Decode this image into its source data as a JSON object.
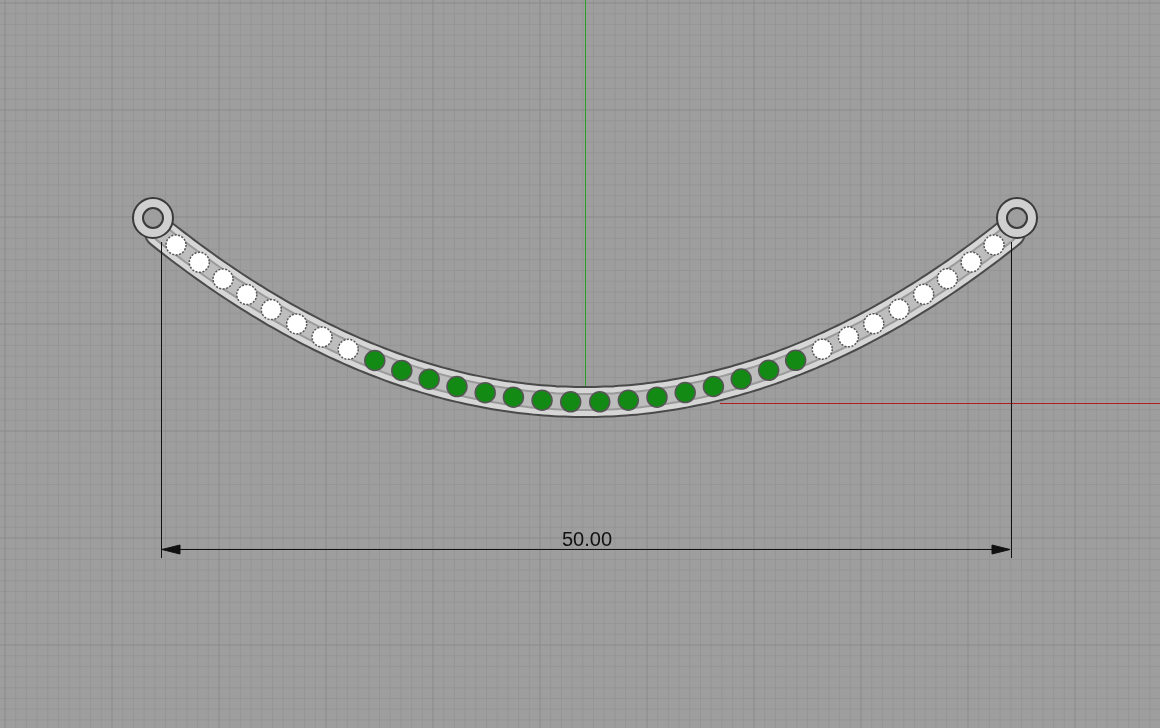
{
  "viewport": {
    "dimension": {
      "label": "50.00"
    },
    "stones": [
      {
        "color": "#ffffff"
      },
      {
        "color": "#ffffff"
      },
      {
        "color": "#ffffff"
      },
      {
        "color": "#ffffff"
      },
      {
        "color": "#ffffff"
      },
      {
        "color": "#ffffff"
      },
      {
        "color": "#ffffff"
      },
      {
        "color": "#ffffff"
      },
      {
        "color": "#138a13"
      },
      {
        "color": "#138a13"
      },
      {
        "color": "#138a13"
      },
      {
        "color": "#138a13"
      },
      {
        "color": "#138a13"
      },
      {
        "color": "#138a13"
      },
      {
        "color": "#138a13"
      },
      {
        "color": "#138a13"
      },
      {
        "color": "#138a13"
      },
      {
        "color": "#138a13"
      },
      {
        "color": "#138a13"
      },
      {
        "color": "#138a13"
      },
      {
        "color": "#138a13"
      },
      {
        "color": "#138a13"
      },
      {
        "color": "#138a13"
      },
      {
        "color": "#138a13"
      },
      {
        "color": "#ffffff"
      },
      {
        "color": "#ffffff"
      },
      {
        "color": "#ffffff"
      },
      {
        "color": "#ffffff"
      },
      {
        "color": "#ffffff"
      },
      {
        "color": "#ffffff"
      },
      {
        "color": "#ffffff"
      },
      {
        "color": "#ffffff"
      }
    ]
  }
}
